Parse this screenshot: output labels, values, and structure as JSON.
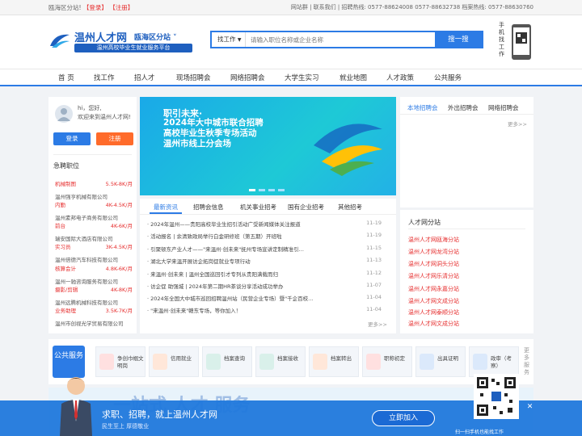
{
  "topbar": {
    "greeting": "瓯海区分站!",
    "login": "【登录】",
    "register": "【注册】",
    "right": "网站群 | 联系我们 | 招聘热线: 0577-88624008 0577-88632738 档案热线: 0577-88630760"
  },
  "header": {
    "title": "温州人才网",
    "branch": "瓯海区分站",
    "sub": "温州高校毕业生就业服务平台",
    "mobile_label": "手机找工作"
  },
  "search": {
    "type": "找工作",
    "placeholder": "请输入职位名称或企业名称",
    "button": "搜一搜"
  },
  "nav": [
    "首 页",
    "找工作",
    "招人才",
    "现场招聘会",
    "网络招聘会",
    "大学生实习",
    "就业地图",
    "人才政策",
    "公共服务"
  ],
  "user": {
    "greet1": "hi，您好,",
    "greet2": "欢迎来到温州人才网!",
    "login": "登录",
    "register": "注册"
  },
  "jobs": {
    "title": "急聘职位",
    "items": [
      {
        "title": "机械制图",
        "salary": "5.5K-8K/月",
        "company": "温州强亨机械有限公司"
      },
      {
        "title": "内勤",
        "salary": "4K-4.5K/月",
        "company": "温州素邦电子商务有限公司"
      },
      {
        "title": "前台",
        "salary": "4K-6K/月",
        "company": "瑞安国际大酒店有限公司"
      },
      {
        "title": "实习员",
        "salary": "3K-4.5K/月",
        "company": "温州倍德汽车科技有限公司"
      },
      {
        "title": "核算会计",
        "salary": "4.8K-6K/月",
        "company": "温州一驰咨询服务有限公司"
      },
      {
        "title": "摄影/剪辑",
        "salary": "4K-8K/月",
        "company": "温州远腾机械科技有限公司"
      },
      {
        "title": "业务助理",
        "salary": "3.5K-7K/月",
        "company": "温州市创视光学贸易有限公司"
      }
    ]
  },
  "banner": {
    "t1": "职引未来·",
    "t2": "2024年大中城市联合招聘",
    "t3": "高校毕业生秋季专场活动",
    "t4": "温州市线上分会场"
  },
  "news_tabs": [
    "最新资讯",
    "招聘会信息",
    "机关事业招考",
    "国有企业招考",
    "其他招考"
  ],
  "news": [
    {
      "title": "2024年温州——贵阳高校毕业生招引活动广受新闻媒体关注报道",
      "date": "11-19"
    },
    {
      "title": "活动报名 | 余清致政局举行白金研修班（第五期）开班啦",
      "date": "11-19"
    },
    {
      "title": "引聚顿东产业人才——\"来温州·创未来\"抚州专场宣讲定制精准引...",
      "date": "11-15"
    },
    {
      "title": "湖北大学来温开展访企拓岗促就业专项行动",
      "date": "11-13"
    },
    {
      "title": "来温州·创未来 | 温州全国巡回引才专列从贵阳满载而归",
      "date": "11-12"
    },
    {
      "title": "访企促 助强城 | 2024年第二期HR茶谈分享活动成功举办",
      "date": "11-07"
    },
    {
      "title": "2024年全国大中城市巡回招聘温州站（民营企业专场）暨\"千企百校...",
      "date": "11-04"
    },
    {
      "title": "\"来温州·创未来\"赣东专场，等你加入！",
      "date": "11-04"
    }
  ],
  "more": "更多>>",
  "right_tabs": [
    "本地招聘会",
    "外出招聘会",
    "网络招聘会"
  ],
  "sites": {
    "title": "人才网分站",
    "items": [
      "温州人才网瓯海分站",
      "温州人才网龙湾分站",
      "温州人才网洞头分站",
      "温州人才网乐清分站",
      "温州人才网永嘉分站",
      "温州人才网文成分站",
      "温州人才网泰顺分站",
      "温州人才网文成分站"
    ]
  },
  "public": {
    "title": "公共服务",
    "items": [
      "争创巾帼文明岗",
      "信用就业",
      "档案查询",
      "档案接收",
      "档案转出",
      "职称初定",
      "出具证明",
      "政审（考察）"
    ],
    "more": "更多服务"
  },
  "footer": {
    "t1": "求职、招聘，就上温州人才网",
    "t2": "民生至上 厚德敬业",
    "button": "立即加入",
    "qr_caption": "扫一扫手机也能找工作",
    "close": "✕"
  },
  "colors": {
    "primary": "#2c7be5",
    "accent": "#e62e2e",
    "orange": "#ff6b2b"
  }
}
